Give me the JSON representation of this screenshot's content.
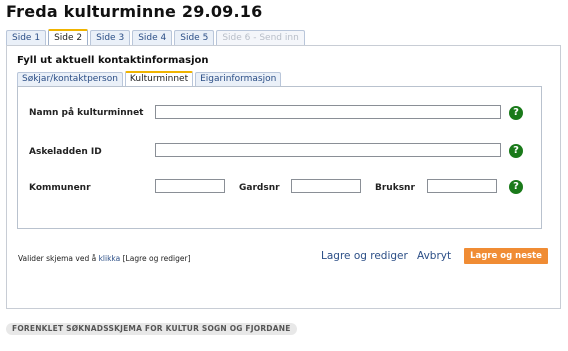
{
  "title": "Freda kulturminne 29.09.16",
  "tabs": [
    {
      "label": "Side 1",
      "state": "normal"
    },
    {
      "label": "Side 2",
      "state": "active"
    },
    {
      "label": "Side 3",
      "state": "normal"
    },
    {
      "label": "Side 4",
      "state": "normal"
    },
    {
      "label": "Side 5",
      "state": "normal"
    },
    {
      "label": "Side 6 - Send inn",
      "state": "disabled"
    }
  ],
  "section_title": "Fyll ut aktuell kontaktinformasjon",
  "sub_tabs": [
    {
      "label": "Søkjar/kontaktperson",
      "state": "normal"
    },
    {
      "label": "Kulturminnet",
      "state": "active"
    },
    {
      "label": "Eigarinformasjon",
      "state": "normal"
    }
  ],
  "form": {
    "name_label": "Namn på kulturminnet",
    "name_value": "",
    "askeladden_label": "Askeladden ID",
    "askeladden_value": "",
    "kommunenr_label": "Kommunenr",
    "kommunenr_value": "",
    "gardsnr_label": "Gardsnr",
    "gardsnr_value": "",
    "bruksnr_label": "Bruksnr",
    "bruksnr_value": "",
    "help_symbol": "?"
  },
  "validate": {
    "prefix": "Valider skjema ved å ",
    "link": "klikka",
    "suffix": " [Lagre og rediger]"
  },
  "actions": {
    "save_edit": "Lagre og rediger",
    "cancel": "Avbryt",
    "save_next": "Lagre og neste"
  },
  "footer": "FORENKLET SØKNADSSKJEMA FOR KULTUR SOGN OG FJORDANE",
  "colors": {
    "accent": "#f08c34",
    "link": "#2b4e86",
    "help": "#1a7a1a",
    "active_tab_border": "#f0b400"
  },
  "icons": [
    "help-icon"
  ]
}
